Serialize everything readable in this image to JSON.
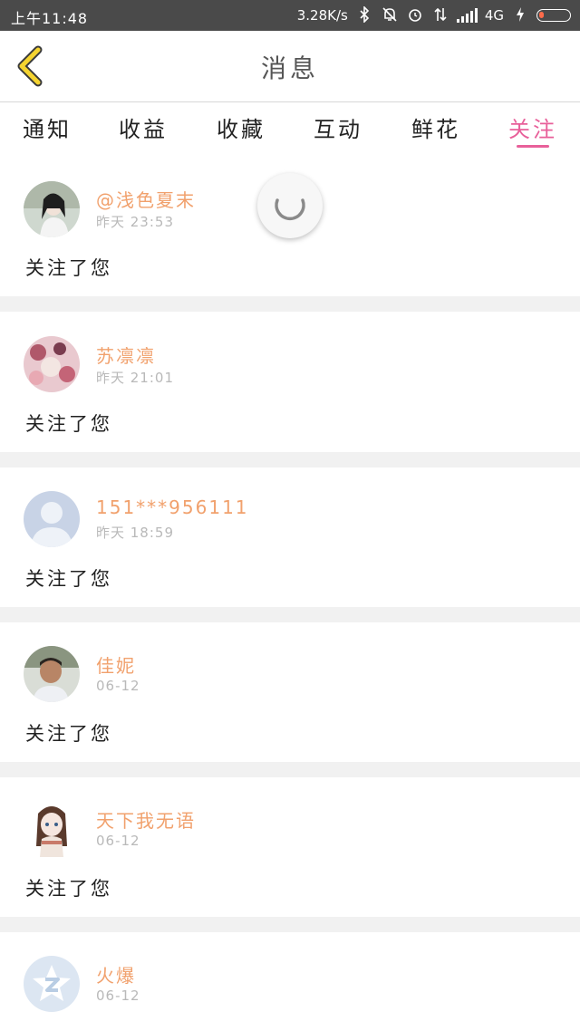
{
  "status_bar": {
    "time": "上午11:48",
    "net_speed": "3.28K/s",
    "network": "4G"
  },
  "header": {
    "title": "消息"
  },
  "tabs": [
    {
      "label": "通知",
      "active": false
    },
    {
      "label": "收益",
      "active": false
    },
    {
      "label": "收藏",
      "active": false
    },
    {
      "label": "互动",
      "active": false
    },
    {
      "label": "鲜花",
      "active": false
    },
    {
      "label": "关注",
      "active": true
    }
  ],
  "feed": [
    {
      "name": "@浅色夏末",
      "time": "昨天 23:53",
      "action": "关注了您",
      "avatar": "girl-photo-avatar"
    },
    {
      "name": "苏凛凛",
      "time": "昨天 21:01",
      "action": "关注了您",
      "avatar": "flowers-photo-avatar"
    },
    {
      "name": "151***956111",
      "time": "昨天 18:59",
      "action": "关注了您",
      "avatar": "default-person-avatar"
    },
    {
      "name": "佳妮",
      "time": "06-12",
      "action": "关注了您",
      "avatar": "child-photo-avatar"
    },
    {
      "name": "天下我无语",
      "time": "06-12",
      "action": "关注了您",
      "avatar": "anime-girl-avatar"
    },
    {
      "name": "火爆",
      "time": "06-12",
      "action": "",
      "avatar": "qzone-logo-avatar"
    }
  ],
  "colors": {
    "accent": "#e8609a",
    "username": "#f1a16d",
    "back_arrow": "#f5d430",
    "status_bar": "#4a4a4a",
    "separator": "#f1f1f1"
  }
}
